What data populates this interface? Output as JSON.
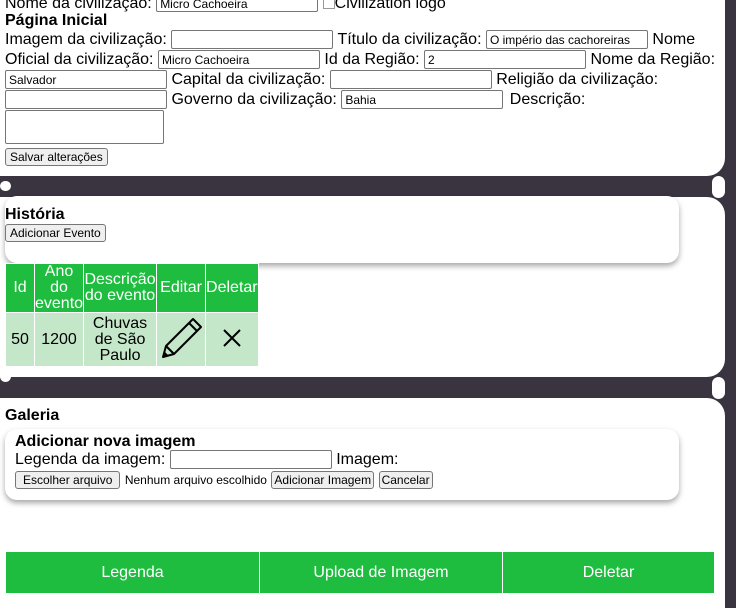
{
  "profile": {
    "name_label": "Nome da civilização:",
    "name_value": "Micro Cachoeira",
    "logo_alt": "Civilization logo",
    "page_title": "Página Inicial",
    "image_label": "Imagem da civilização:",
    "image_value": "",
    "title_label": "Título da civilização:",
    "title_value": "O império das cachoreiras",
    "official_name_label_1": "Nome",
    "official_name_label_2": "Oficial da civilização:",
    "official_name_value": "Micro Cachoeira",
    "region_id_label": "Id da Região:",
    "region_id_value": "2",
    "region_name_label": "Nome da Região:",
    "region_name_value": "Salvador",
    "capital_label": "Capital da civilização:",
    "capital_value": "",
    "religion_label": "Religião da civilização:",
    "religion_value": "",
    "government_label": "Governo da civilização:",
    "government_value": "Bahia",
    "description_label": "Descrição:",
    "description_value": "",
    "save_button": "Salvar alterações"
  },
  "history": {
    "title": "História",
    "add_event_button": "Adicionar Evento",
    "columns": [
      "Id",
      "Ano do evento",
      "Descrição do evento",
      "Editar",
      "Deletar"
    ],
    "rows": [
      {
        "id": "50",
        "year": "1200",
        "description": "Chuvas de São Paulo",
        "edit_icon": "pencil-icon",
        "delete_icon": "close-icon"
      }
    ]
  },
  "gallery": {
    "title": "Galeria",
    "add_title": "Adicionar nova imagem",
    "caption_label": "Legenda da imagem:",
    "caption_value": "",
    "image_label": "Imagem:",
    "choose_file_button": "Escolher arquivo",
    "no_file_text": "Nenhum arquivo escolhido",
    "add_image_button": "Adicionar Imagem",
    "cancel_button": "Cancelar",
    "columns": [
      "Legenda",
      "Upload de Imagem",
      "Deletar"
    ]
  },
  "colors": {
    "accent_green": "#1ebd3f",
    "row_green": "#c4e6c9",
    "backdrop": "#3a3340"
  }
}
